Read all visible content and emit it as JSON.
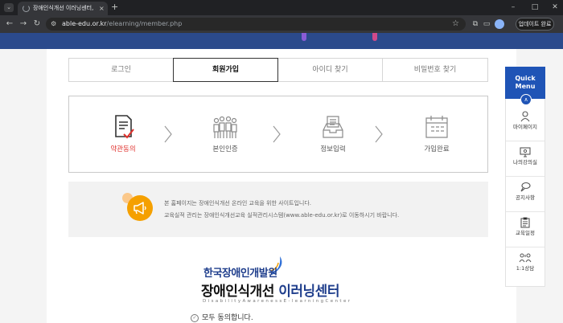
{
  "browser": {
    "tab_title": "장애인식개선 이러닝센터, 회원",
    "tab_close": "×",
    "new_tab": "+",
    "tab_menu": "⌄",
    "url_host": "able-edu.or.kr",
    "url_path": "/elearning/member.php",
    "update_button": "업데이트 완료",
    "window_controls": [
      "–",
      "□",
      "✕"
    ]
  },
  "member_tabs": [
    {
      "label": "로그인",
      "active": false
    },
    {
      "label": "회원가입",
      "active": true
    },
    {
      "label": "아이디 찾기",
      "active": false
    },
    {
      "label": "비밀번호 찾기",
      "active": false
    }
  ],
  "steps": [
    {
      "label": "약관동의",
      "icon": "document-check-icon",
      "active": true
    },
    {
      "label": "본인인증",
      "icon": "people-group-icon",
      "active": false
    },
    {
      "label": "정보입력",
      "icon": "info-form-icon",
      "active": false
    },
    {
      "label": "가입완료",
      "icon": "calendar-complete-icon",
      "active": false
    }
  ],
  "notice": {
    "line1": "본 홈페이지는 장애인식개선 온라인 교육을 위한 사이트입니다.",
    "line2": "교육실적 관리는 장애인식개선교육 실적관리시스템(www.able-edu.or.kr)로 이동하시기 바랍니다.",
    "icon": "megaphone-icon",
    "accent_color": "#f5a000"
  },
  "logo": {
    "org": "한국장애인개발원",
    "main_prefix": "장애인식개선",
    "main_accent": "이러닝센터",
    "sub": "DisabilityAwarenessE-learningCenter"
  },
  "agree": {
    "label": "모두 동의합니다."
  },
  "quick_menu": {
    "title_line1": "Quick",
    "title_line2": "Menu",
    "items": [
      {
        "label": "마이페이지",
        "icon": "person-icon"
      },
      {
        "label": "나의강의실",
        "icon": "monitor-icon"
      },
      {
        "label": "공지사항",
        "icon": "speech-bubble-icon"
      },
      {
        "label": "교육일정",
        "icon": "clipboard-icon"
      },
      {
        "label": "1:1상담",
        "icon": "counsel-icon"
      }
    ]
  },
  "colors": {
    "active_step": "#e0312d",
    "quick_menu": "#1f54b6",
    "logo_blue": "#1f3e8c"
  }
}
